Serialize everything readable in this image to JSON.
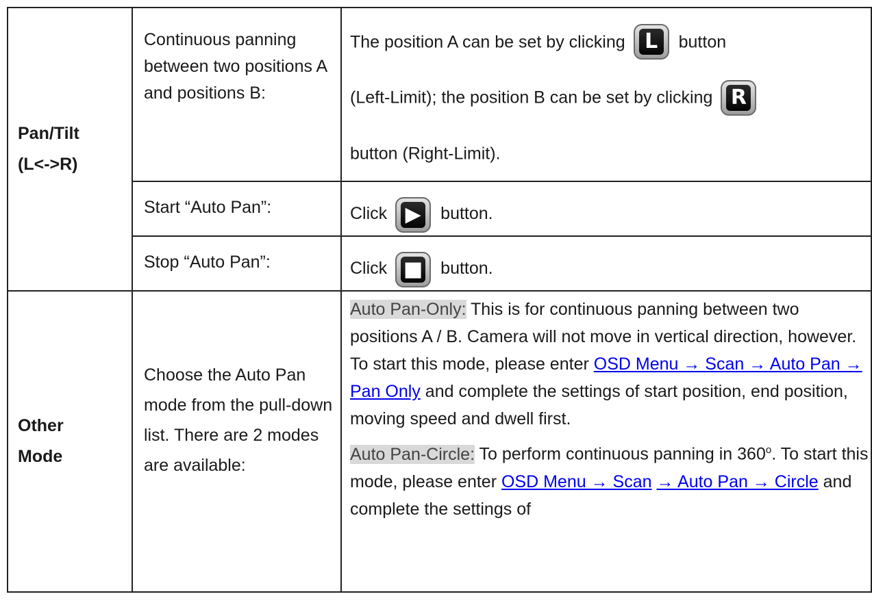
{
  "rows": {
    "pan_tilt": {
      "label_line1": "Pan/Tilt",
      "label_line2": "(L<->R)",
      "sub1": {
        "title": "Continuous panning between two positions A and positions B:",
        "desc_a": "The position A can be set by clicking",
        "desc_b": "button",
        "desc_c": "(Left-Limit); the position B can be set by clicking",
        "desc_d": "button (Right-Limit).",
        "icon_l_letter": "L",
        "icon_r_letter": "R"
      },
      "sub2": {
        "title": "Start “Auto Pan”:",
        "click": "Click",
        "button": "button."
      },
      "sub3": {
        "title": "Stop “Auto Pan”:",
        "click": "Click",
        "button": "button."
      }
    },
    "other_mode": {
      "label_line1": "Other",
      "label_line2": "Mode",
      "title": "Choose the Auto Pan mode from the pull-down list. There are 2 modes are available:",
      "mode1_tag": "Auto Pan-Only:",
      "mode1_text1": " This is for continuous panning between two positions A / B. Camera will not move in vertical direction, however. To start this mode, please enter ",
      "mode1_link": "OSD Menu → Scan → Auto Pan → Pan Only",
      "mode1_text2": " and complete the settings of start position, end position, moving speed and dwell first.",
      "mode2_tag": "Auto Pan-Circle:",
      "mode2_text1": " To perform continuous panning in 360",
      "mode2_sup": "o",
      "mode2_text1b": ". To start this mode, please enter ",
      "mode2_link1": "OSD Menu → Scan",
      "mode2_link2": "→ Auto Pan → Circle",
      "mode2_text2": " and complete the settings of"
    }
  }
}
